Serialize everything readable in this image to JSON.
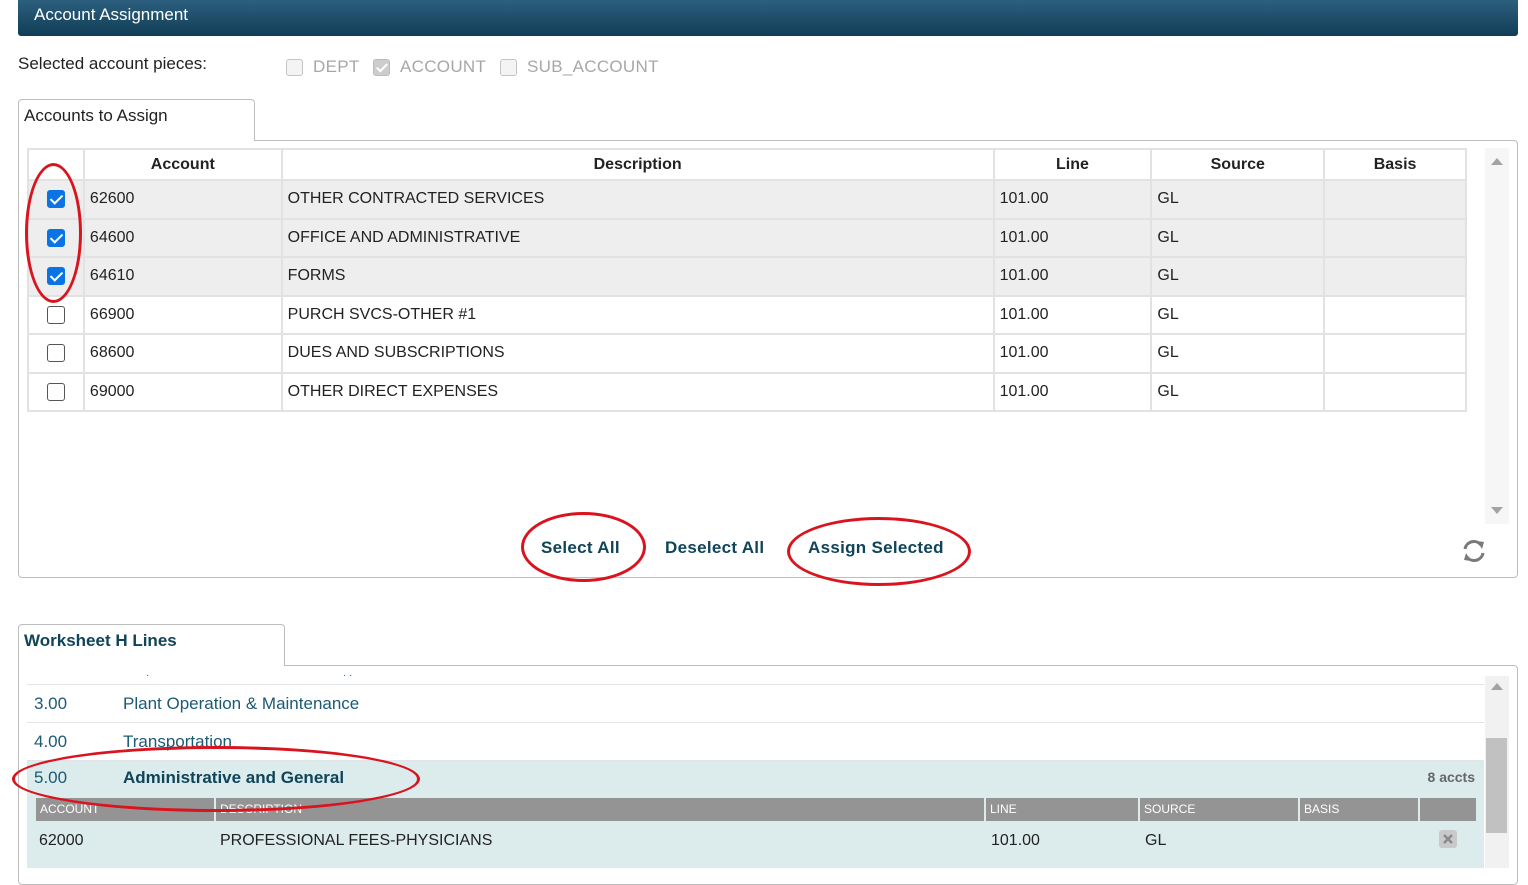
{
  "header": {
    "title": "Account Assignment"
  },
  "pieces": {
    "label": "Selected account pieces:",
    "items": [
      {
        "name": "DEPT",
        "checked": false
      },
      {
        "name": "ACCOUNT",
        "checked": true
      },
      {
        "name": "SUB_ACCOUNT",
        "checked": false
      }
    ]
  },
  "accounts_tab": {
    "label": "Accounts to Assign"
  },
  "accounts_table": {
    "headers": [
      "Account",
      "Description",
      "Line",
      "Source",
      "Basis"
    ],
    "rows": [
      {
        "checked": true,
        "account": "62600",
        "description": "OTHER CONTRACTED SERVICES",
        "line": "101.00",
        "source": "GL",
        "basis": ""
      },
      {
        "checked": true,
        "account": "64600",
        "description": "OFFICE AND ADMINISTRATIVE",
        "line": "101.00",
        "source": "GL",
        "basis": ""
      },
      {
        "checked": true,
        "account": "64610",
        "description": "FORMS",
        "line": "101.00",
        "source": "GL",
        "basis": ""
      },
      {
        "checked": false,
        "account": "66900",
        "description": "PURCH SVCS-OTHER #1",
        "line": "101.00",
        "source": "GL",
        "basis": ""
      },
      {
        "checked": false,
        "account": "68600",
        "description": "DUES AND SUBSCRIPTIONS",
        "line": "101.00",
        "source": "GL",
        "basis": ""
      },
      {
        "checked": false,
        "account": "69000",
        "description": "OTHER DIRECT EXPENSES",
        "line": "101.00",
        "source": "GL",
        "basis": ""
      }
    ]
  },
  "actions": {
    "select_all": "Select All",
    "deselect_all": "Deselect All",
    "assign_selected": "Assign Selected",
    "refresh_icon": "refresh-icon"
  },
  "worksheet_tab": {
    "label": "Worksheet H Lines"
  },
  "worksheet_lines": [
    {
      "number": "3.00",
      "name": "Plant Operation & Maintenance"
    },
    {
      "number": "4.00",
      "name": "Transportation"
    }
  ],
  "active_line": {
    "number": "5.00",
    "name": "Administrative and General",
    "count": "8 accts",
    "sub_headers": [
      "ACCOUNT",
      "DESCRIPTION",
      "LINE",
      "SOURCE",
      "BASIS"
    ],
    "sub_rows": [
      {
        "account": "62000",
        "description": "PROFESSIONAL FEES-PHYSICIANS",
        "line": "101.00",
        "source": "GL",
        "basis": ""
      }
    ]
  },
  "colors": {
    "header_bar": "#1b4a66",
    "link": "#0f4459",
    "annotation": "#d9141e",
    "checkbox": "#0b74e5"
  }
}
